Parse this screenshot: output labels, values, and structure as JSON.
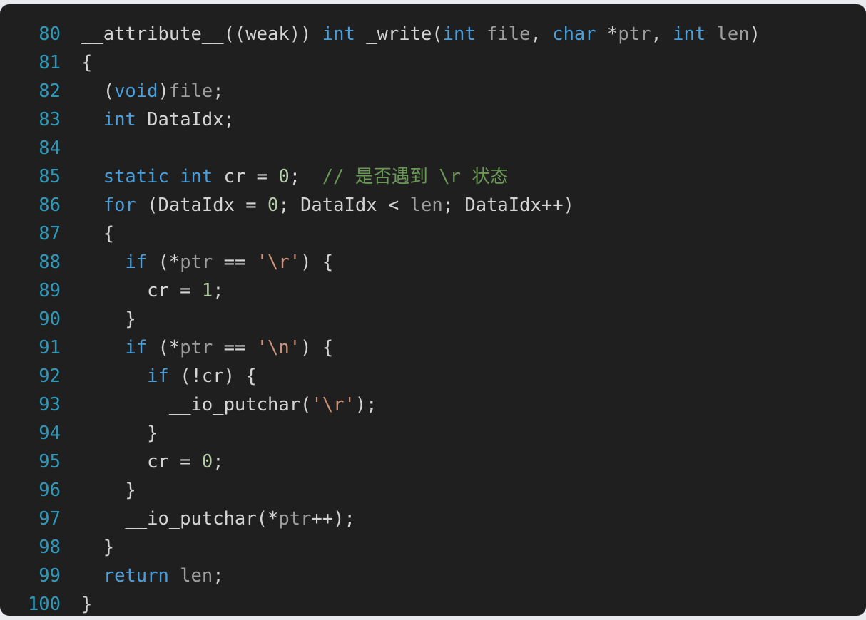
{
  "editor": {
    "background_color": "#1f1f1f",
    "page_background_color": "#e8eaed",
    "gutter_color": "#2f98b8",
    "default_text_color": "#d4d4d4",
    "first_line_number": 80,
    "last_line_number": 100,
    "language": "c",
    "theme_colors": {
      "keyword": "#4a9eda",
      "number": "#b5cea8",
      "string": "#ce9178",
      "comment": "#6a9955",
      "parameter": "#9d9d9d",
      "identifier": "#d4d4d4"
    }
  },
  "lines": [
    {
      "number": "80",
      "text": "__attribute__((weak)) int _write(int file, char *ptr, int len)",
      "tokens": [
        {
          "t": "__attribute__((weak)) ",
          "c": "id"
        },
        {
          "t": "int",
          "c": "kw"
        },
        {
          "t": " _write(",
          "c": "id"
        },
        {
          "t": "int",
          "c": "kw"
        },
        {
          "t": " ",
          "c": "id"
        },
        {
          "t": "file",
          "c": "par"
        },
        {
          "t": ", ",
          "c": "id"
        },
        {
          "t": "char",
          "c": "kw"
        },
        {
          "t": " *",
          "c": "id"
        },
        {
          "t": "ptr",
          "c": "par"
        },
        {
          "t": ", ",
          "c": "id"
        },
        {
          "t": "int",
          "c": "kw"
        },
        {
          "t": " ",
          "c": "id"
        },
        {
          "t": "len",
          "c": "par"
        },
        {
          "t": ")",
          "c": "id"
        }
      ]
    },
    {
      "number": "81",
      "text": "{",
      "tokens": [
        {
          "t": "{",
          "c": "id"
        }
      ]
    },
    {
      "number": "82",
      "text": "  (void)file;",
      "tokens": [
        {
          "t": "  (",
          "c": "id"
        },
        {
          "t": "void",
          "c": "kw"
        },
        {
          "t": ")",
          "c": "id"
        },
        {
          "t": "file",
          "c": "par"
        },
        {
          "t": ";",
          "c": "id"
        }
      ]
    },
    {
      "number": "83",
      "text": "  int DataIdx;",
      "tokens": [
        {
          "t": "  ",
          "c": "id"
        },
        {
          "t": "int",
          "c": "kw"
        },
        {
          "t": " DataIdx;",
          "c": "id"
        }
      ]
    },
    {
      "number": "84",
      "text": "",
      "tokens": []
    },
    {
      "number": "85",
      "text": "  static int cr = 0;  // 是否遇到 \\r 状态",
      "tokens": [
        {
          "t": "  ",
          "c": "id"
        },
        {
          "t": "static",
          "c": "kw"
        },
        {
          "t": " ",
          "c": "id"
        },
        {
          "t": "int",
          "c": "kw"
        },
        {
          "t": " cr = ",
          "c": "id"
        },
        {
          "t": "0",
          "c": "num"
        },
        {
          "t": ";  ",
          "c": "id"
        },
        {
          "t": "// ",
          "c": "cmt"
        },
        {
          "t": "是否遇到",
          "c": "cmt cjk"
        },
        {
          "t": " \\r ",
          "c": "cmt"
        },
        {
          "t": "状态",
          "c": "cmt cjk"
        }
      ]
    },
    {
      "number": "86",
      "text": "  for (DataIdx = 0; DataIdx < len; DataIdx++)",
      "tokens": [
        {
          "t": "  ",
          "c": "id"
        },
        {
          "t": "for",
          "c": "kw"
        },
        {
          "t": " (DataIdx = ",
          "c": "id"
        },
        {
          "t": "0",
          "c": "num"
        },
        {
          "t": "; DataIdx < ",
          "c": "id"
        },
        {
          "t": "len",
          "c": "par"
        },
        {
          "t": "; DataIdx++)",
          "c": "id"
        }
      ]
    },
    {
      "number": "87",
      "text": "  {",
      "tokens": [
        {
          "t": "  {",
          "c": "id"
        }
      ]
    },
    {
      "number": "88",
      "text": "    if (*ptr == '\\r') {",
      "tokens": [
        {
          "t": "    ",
          "c": "id"
        },
        {
          "t": "if",
          "c": "kw"
        },
        {
          "t": " (*",
          "c": "id"
        },
        {
          "t": "ptr",
          "c": "par"
        },
        {
          "t": " == ",
          "c": "id"
        },
        {
          "t": "'\\r'",
          "c": "str"
        },
        {
          "t": ") {",
          "c": "id"
        }
      ]
    },
    {
      "number": "89",
      "text": "      cr = 1;",
      "tokens": [
        {
          "t": "      cr = ",
          "c": "id"
        },
        {
          "t": "1",
          "c": "num"
        },
        {
          "t": ";",
          "c": "id"
        }
      ]
    },
    {
      "number": "90",
      "text": "    }",
      "tokens": [
        {
          "t": "    }",
          "c": "id"
        }
      ]
    },
    {
      "number": "91",
      "text": "    if (*ptr == '\\n') {",
      "tokens": [
        {
          "t": "    ",
          "c": "id"
        },
        {
          "t": "if",
          "c": "kw"
        },
        {
          "t": " (*",
          "c": "id"
        },
        {
          "t": "ptr",
          "c": "par"
        },
        {
          "t": " == ",
          "c": "id"
        },
        {
          "t": "'\\n'",
          "c": "str"
        },
        {
          "t": ") {",
          "c": "id"
        }
      ]
    },
    {
      "number": "92",
      "text": "      if (!cr) {",
      "tokens": [
        {
          "t": "      ",
          "c": "id"
        },
        {
          "t": "if",
          "c": "kw"
        },
        {
          "t": " (!cr) {",
          "c": "id"
        }
      ]
    },
    {
      "number": "93",
      "text": "        __io_putchar('\\r');",
      "tokens": [
        {
          "t": "        __io_putchar(",
          "c": "id"
        },
        {
          "t": "'\\r'",
          "c": "str"
        },
        {
          "t": ");",
          "c": "id"
        }
      ]
    },
    {
      "number": "94",
      "text": "      }",
      "tokens": [
        {
          "t": "      }",
          "c": "id"
        }
      ]
    },
    {
      "number": "95",
      "text": "      cr = 0;",
      "tokens": [
        {
          "t": "      cr = ",
          "c": "id"
        },
        {
          "t": "0",
          "c": "num"
        },
        {
          "t": ";",
          "c": "id"
        }
      ]
    },
    {
      "number": "96",
      "text": "    }",
      "tokens": [
        {
          "t": "    }",
          "c": "id"
        }
      ]
    },
    {
      "number": "97",
      "text": "    __io_putchar(*ptr++);",
      "tokens": [
        {
          "t": "    __io_putchar(*",
          "c": "id"
        },
        {
          "t": "ptr",
          "c": "par"
        },
        {
          "t": "++);",
          "c": "id"
        }
      ]
    },
    {
      "number": "98",
      "text": "  }",
      "tokens": [
        {
          "t": "  }",
          "c": "id"
        }
      ]
    },
    {
      "number": "99",
      "text": "  return len;",
      "tokens": [
        {
          "t": "  ",
          "c": "id"
        },
        {
          "t": "return",
          "c": "kw"
        },
        {
          "t": " ",
          "c": "id"
        },
        {
          "t": "len",
          "c": "par"
        },
        {
          "t": ";",
          "c": "id"
        }
      ]
    },
    {
      "number": "100",
      "text": "}",
      "tokens": [
        {
          "t": "}",
          "c": "id"
        }
      ]
    }
  ]
}
